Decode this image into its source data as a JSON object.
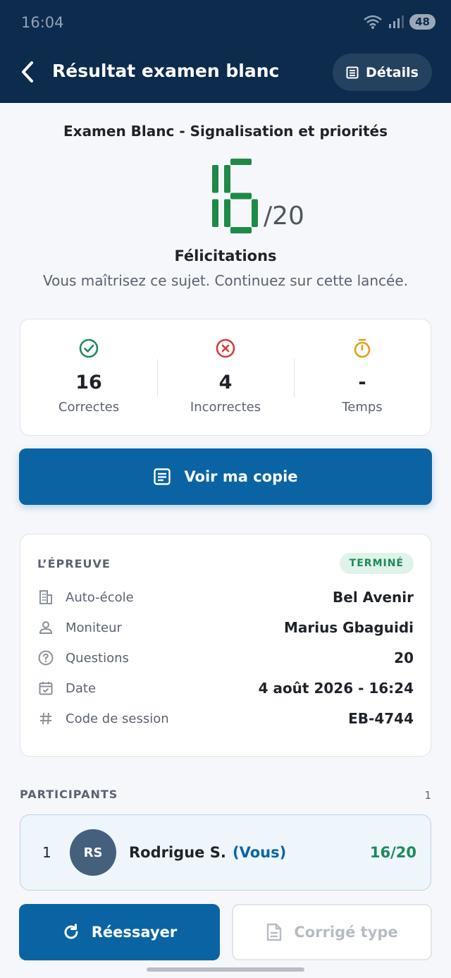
{
  "status_bar": {
    "time": "16:04",
    "battery": "48"
  },
  "header": {
    "title": "Résultat examen blanc",
    "details_label": "Détails"
  },
  "exam": {
    "name": "Examen Blanc - Signalisation et priorités"
  },
  "score": {
    "value": "16",
    "total": "/20"
  },
  "message": {
    "title": "Félicitations",
    "subtitle": "Vous maîtrisez ce sujet. Continuez sur cette lancée."
  },
  "stats": [
    {
      "value": "16",
      "label": "Correctes",
      "icon": "check-circle-icon",
      "color": "#1c8a5a"
    },
    {
      "value": "4",
      "label": "Incorrectes",
      "icon": "x-circle-icon",
      "color": "#d83a3a"
    },
    {
      "value": "-",
      "label": "Temps",
      "icon": "stopwatch-icon",
      "color": "#e0a11b"
    }
  ],
  "actions": {
    "view_copy": "Voir ma copie",
    "retry": "Réessayer",
    "answer_key": "Corrigé type"
  },
  "exam_info": {
    "heading": "L’ÉPREUVE",
    "status": "TERMINÉ",
    "rows": [
      {
        "label": "Auto-école",
        "value": "Bel Avenir",
        "icon": "building-icon"
      },
      {
        "label": "Moniteur",
        "value": "Marius Gbaguidi",
        "icon": "person-icon"
      },
      {
        "label": "Questions",
        "value": "20",
        "icon": "help-circle-icon"
      },
      {
        "label": "Date",
        "value": "4 août 2026 - 16:24",
        "icon": "calendar-check-icon"
      },
      {
        "label": "Code de session",
        "value": "EB-4744",
        "icon": "hash-icon"
      }
    ]
  },
  "participants": {
    "heading": "PARTICIPANTS",
    "count": "1",
    "items": [
      {
        "rank": "1",
        "initials": "RS",
        "name": "Rodrigue S.",
        "you_label": "(Vous)",
        "score": "16/20"
      }
    ]
  },
  "colors": {
    "header_bg": "#0c2b4d",
    "primary": "#0a64a3",
    "success": "#1c8a5a",
    "score_digits": "#1e8a47"
  }
}
